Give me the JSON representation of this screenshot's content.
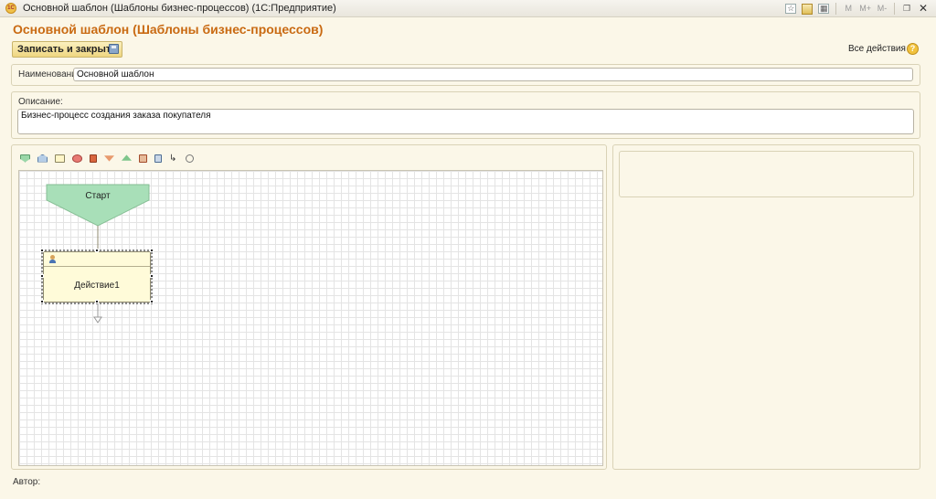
{
  "window": {
    "title": "Основной шаблон (Шаблоны бизнес-процессов)  (1С:Предприятие)",
    "app_icon": "1c-logo-icon",
    "buttons": [
      "M",
      "M+",
      "M-"
    ]
  },
  "header": {
    "title": "Основной шаблон (Шаблоны бизнес-процессов)",
    "save_close_label": "Записать и закрыть",
    "all_actions_label": "Все действия ▾",
    "help_label": "?"
  },
  "form": {
    "name_label": "Наименование:",
    "name_value": "Основной шаблон",
    "description_label": "Описание:",
    "description_value": "Бизнес-процесс создания заказа покупателя",
    "author_label": "Автор:"
  },
  "diagram": {
    "toolbar_icons": [
      "start-point-icon",
      "end-point-icon",
      "action-icon",
      "condition-icon",
      "split-icon",
      "select-icon",
      "merge-icon",
      "nested-process-icon",
      "processing-icon",
      "connector-icon",
      "decoration-icon"
    ],
    "nodes": {
      "start_label": "Старт",
      "action_label": "Действие1"
    }
  },
  "colors": {
    "title_color": "#c96a12",
    "start_node": "#a8dfb8",
    "action_node": "#fffbd9",
    "background": "#fbf7e8"
  }
}
